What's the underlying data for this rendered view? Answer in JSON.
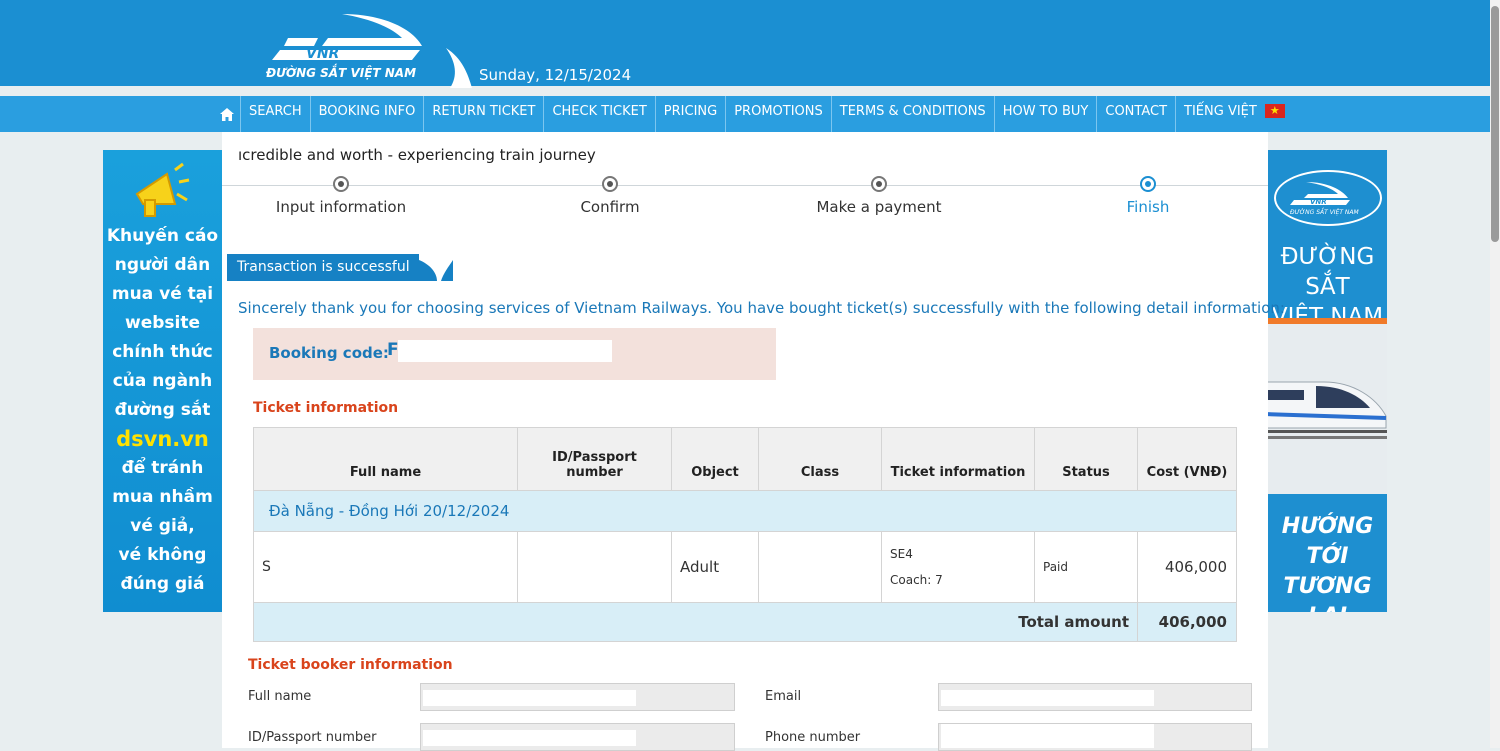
{
  "header": {
    "logo_text": "VNR",
    "logo_subtitle": "ĐƯỜNG SẮT VIỆT NAM",
    "date": "Sunday, 12/15/2024"
  },
  "nav": {
    "items": [
      "SEARCH",
      "BOOKING INFO",
      "RETURN TICKET",
      "CHECK TICKET",
      "PRICING",
      "PROMOTIONS",
      "TERMS & CONDITIONS",
      "HOW TO BUY",
      "CONTACT"
    ],
    "language": "TIẾNG VIỆT"
  },
  "marquee": "ıcredible and worth - experiencing train journey",
  "steps": [
    {
      "label": "Input information",
      "active": false
    },
    {
      "label": "Confirm",
      "active": false
    },
    {
      "label": "Make a payment",
      "active": false
    },
    {
      "label": "Finish",
      "active": true
    }
  ],
  "success_title": "Transaction is successful",
  "thanks_text": "Sincerely thank you for choosing services of Vietnam Railways. You have bought ticket(s) successfully with the following detail information:",
  "booking": {
    "label": "Booking code:",
    "value": "F"
  },
  "ticket_section_title": "Ticket information",
  "table": {
    "headers": [
      "Full name",
      "ID/Passport number",
      "Object",
      "Class",
      "Ticket information",
      "Status",
      "Cost (VNĐ)"
    ],
    "route": "Đà Nẵng - Đồng Hới 20/12/2024",
    "row": {
      "name": "S",
      "passport": "",
      "object": "Adult",
      "class": "",
      "train": "SE4",
      "coach": "Coach: 7",
      "status": "Paid",
      "cost": "406,000"
    },
    "total_label": "Total amount",
    "total_value": "406,000"
  },
  "booker_section_title": "Ticket booker information",
  "booker_fields": {
    "full_name": "Full name",
    "email": "Email",
    "passport": "ID/Passport number",
    "phone": "Phone number"
  },
  "left_banner": {
    "lines": [
      "Khuyến cáo",
      "người dân",
      "mua vé tại",
      "website",
      "chính thức",
      "của ngành",
      "đường sắt"
    ],
    "highlight": "dsvn.vn",
    "lines2": [
      "để tránh",
      "mua nhầm",
      "vé giả,",
      "vé không",
      "đúng giá"
    ]
  },
  "right_banner": {
    "logo_text": "VNR",
    "logo_subtitle": "ĐƯỜNG SẮT VIỆT NAM",
    "title": [
      "ĐƯỜNG SẮT",
      "VIỆT NAM"
    ],
    "bottom": [
      "HƯỚNG TỚI",
      "TƯƠNG LAI"
    ]
  },
  "colors": {
    "primary": "#1b8fd2",
    "nav": "#2a9ee0",
    "accent": "#d9441c",
    "booking_bg": "#f3e1dc",
    "row_bg": "#d8eef7"
  }
}
